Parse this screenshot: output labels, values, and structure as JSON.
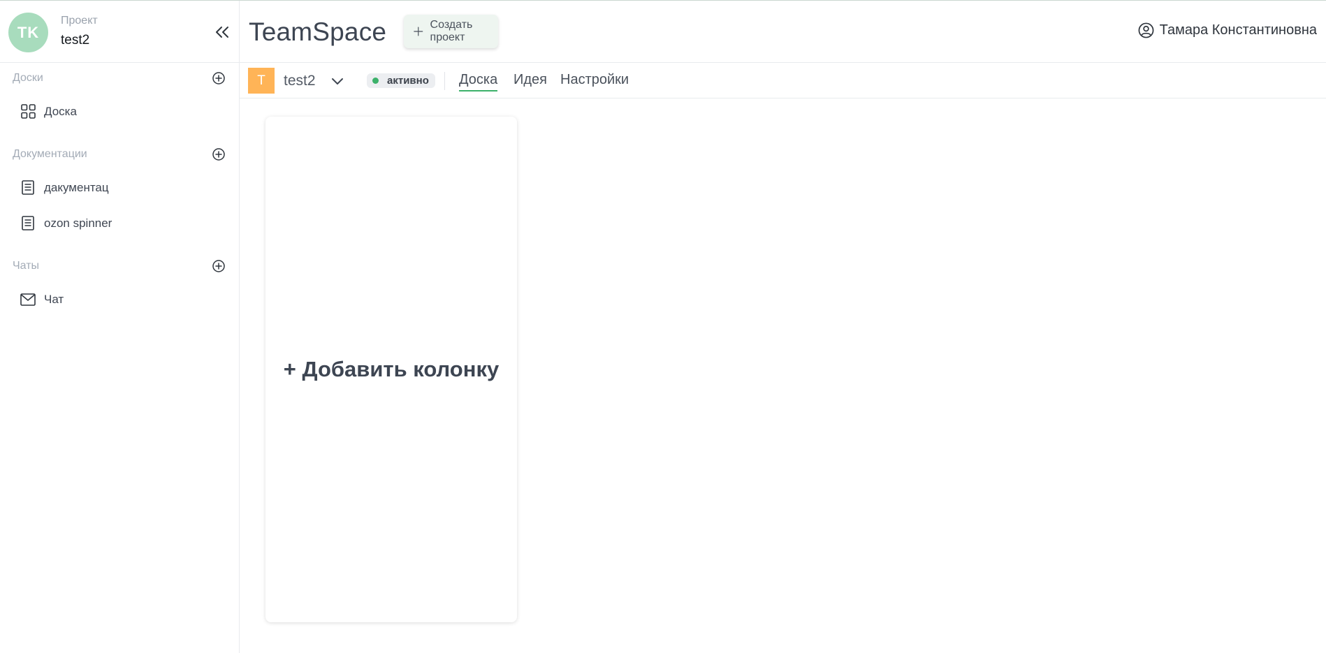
{
  "project": {
    "avatar_initials": "TK",
    "label": "Проект",
    "name": "test2"
  },
  "sidebar": {
    "sections": [
      {
        "title": "Доски",
        "items": [
          {
            "label": "Доска",
            "icon": "grid-icon"
          }
        ]
      },
      {
        "title": "Документации",
        "items": [
          {
            "label": "дакументац",
            "icon": "document-icon"
          },
          {
            "label": "ozon spinner",
            "icon": "document-icon"
          }
        ]
      },
      {
        "title": "Чаты",
        "items": [
          {
            "label": "Чат",
            "icon": "mail-icon"
          }
        ]
      }
    ]
  },
  "header": {
    "brand": "TeamSpace",
    "create_label": "Создать проект",
    "user_name": "Тамара Константиновна"
  },
  "projectbar": {
    "badge": "T",
    "name": "test2",
    "status": "активно",
    "tabs": [
      "Доска",
      "Идея",
      "Настройки"
    ],
    "active_tab": "Доска"
  },
  "board": {
    "add_column_label": "+ Добавить колонку"
  },
  "colors": {
    "accent": "#3cb16a",
    "avatar_bg": "#a8dcbd",
    "project_badge_bg": "#ffb457",
    "create_btn_bg": "#eef5f0"
  }
}
